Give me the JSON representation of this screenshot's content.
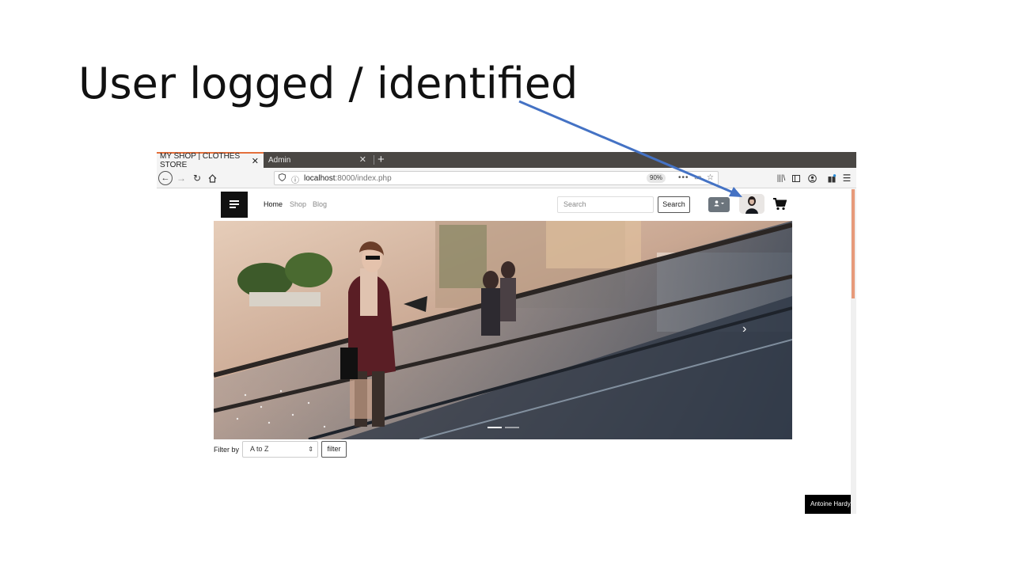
{
  "slide": {
    "title": "User logged / identified",
    "arrow_color": "#4472c4"
  },
  "browser": {
    "tabs": [
      {
        "label": "MY SHOP | CLOTHES STORE",
        "active": true
      },
      {
        "label": "Admin",
        "active": false
      }
    ],
    "close_glyph": "✕",
    "new_tab_glyph": "+",
    "url_host": "localhost",
    "url_rest": ":8000/index.php",
    "zoom": "90%",
    "accent_tab_color": "#e46f3c",
    "icons": [
      "back-arrow-icon",
      "forward-arrow-icon",
      "reload-icon",
      "home-icon",
      "shield-icon",
      "info-icon",
      "more-icon",
      "reader-icon",
      "bookmark-star-icon",
      "library-icon",
      "sidebar-icon",
      "account-icon",
      "extensions-icon",
      "hamburger-menu-icon"
    ]
  },
  "site": {
    "nav": {
      "home": "Home",
      "shop": "Shop",
      "blog": "Blog"
    },
    "search": {
      "placeholder": "Search",
      "button": "Search"
    },
    "filter": {
      "label": "Filter by",
      "selected": "A to Z",
      "button": "filter"
    },
    "photo_credit": "Antoine Hardy, J"
  }
}
